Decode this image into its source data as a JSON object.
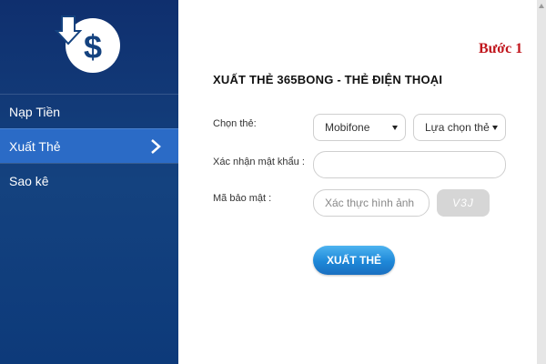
{
  "sidebar": {
    "logo_icon": "withdraw-dollar-icon",
    "items": [
      {
        "label": "Nạp Tiền"
      },
      {
        "label": "Xuất Thẻ"
      },
      {
        "label": "Sao kê"
      }
    ]
  },
  "main": {
    "step": "Bước 1",
    "title": "XUẤT THẺ 365BONG - THẺ ĐIỆN THOẠI",
    "card_label": "Chọn thẻ:",
    "provider_value": "Mobifone",
    "card_value": "Lựa chọn thẻ",
    "password_label": "Xác nhận mật khẩu :",
    "password_value": "",
    "security_label": "Mã bảo mật :",
    "security_placeholder": "Xác thực hình ảnh",
    "captcha_text": "V3J",
    "submit_label": "XUẤT THẺ"
  },
  "colors": {
    "sidebar": "#14427f",
    "active_item": "#2b6bc6",
    "step_red": "#c0151c",
    "button": "#1e88d8"
  }
}
